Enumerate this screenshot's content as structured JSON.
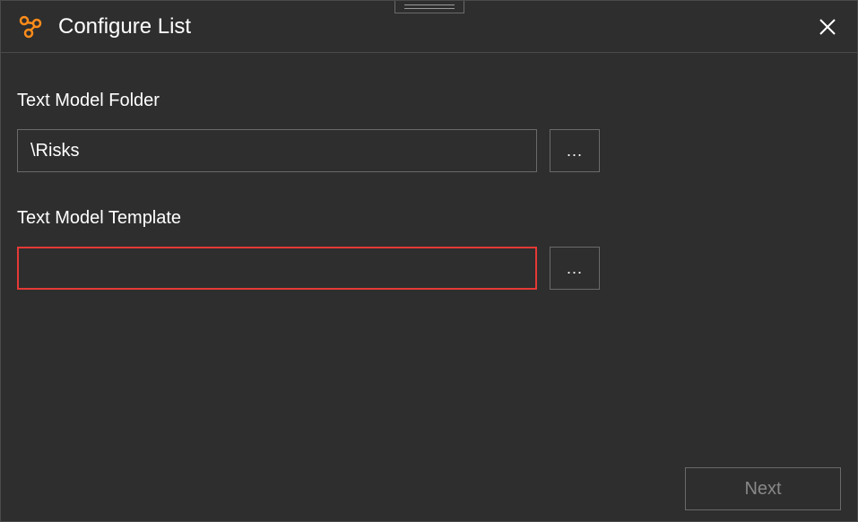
{
  "header": {
    "title": "Configure List"
  },
  "fields": {
    "folder": {
      "label": "Text Model Folder",
      "value": "\\Risks",
      "browse": "..."
    },
    "template": {
      "label": "Text Model Template",
      "value": "",
      "browse": "..."
    }
  },
  "footer": {
    "next": "Next"
  }
}
